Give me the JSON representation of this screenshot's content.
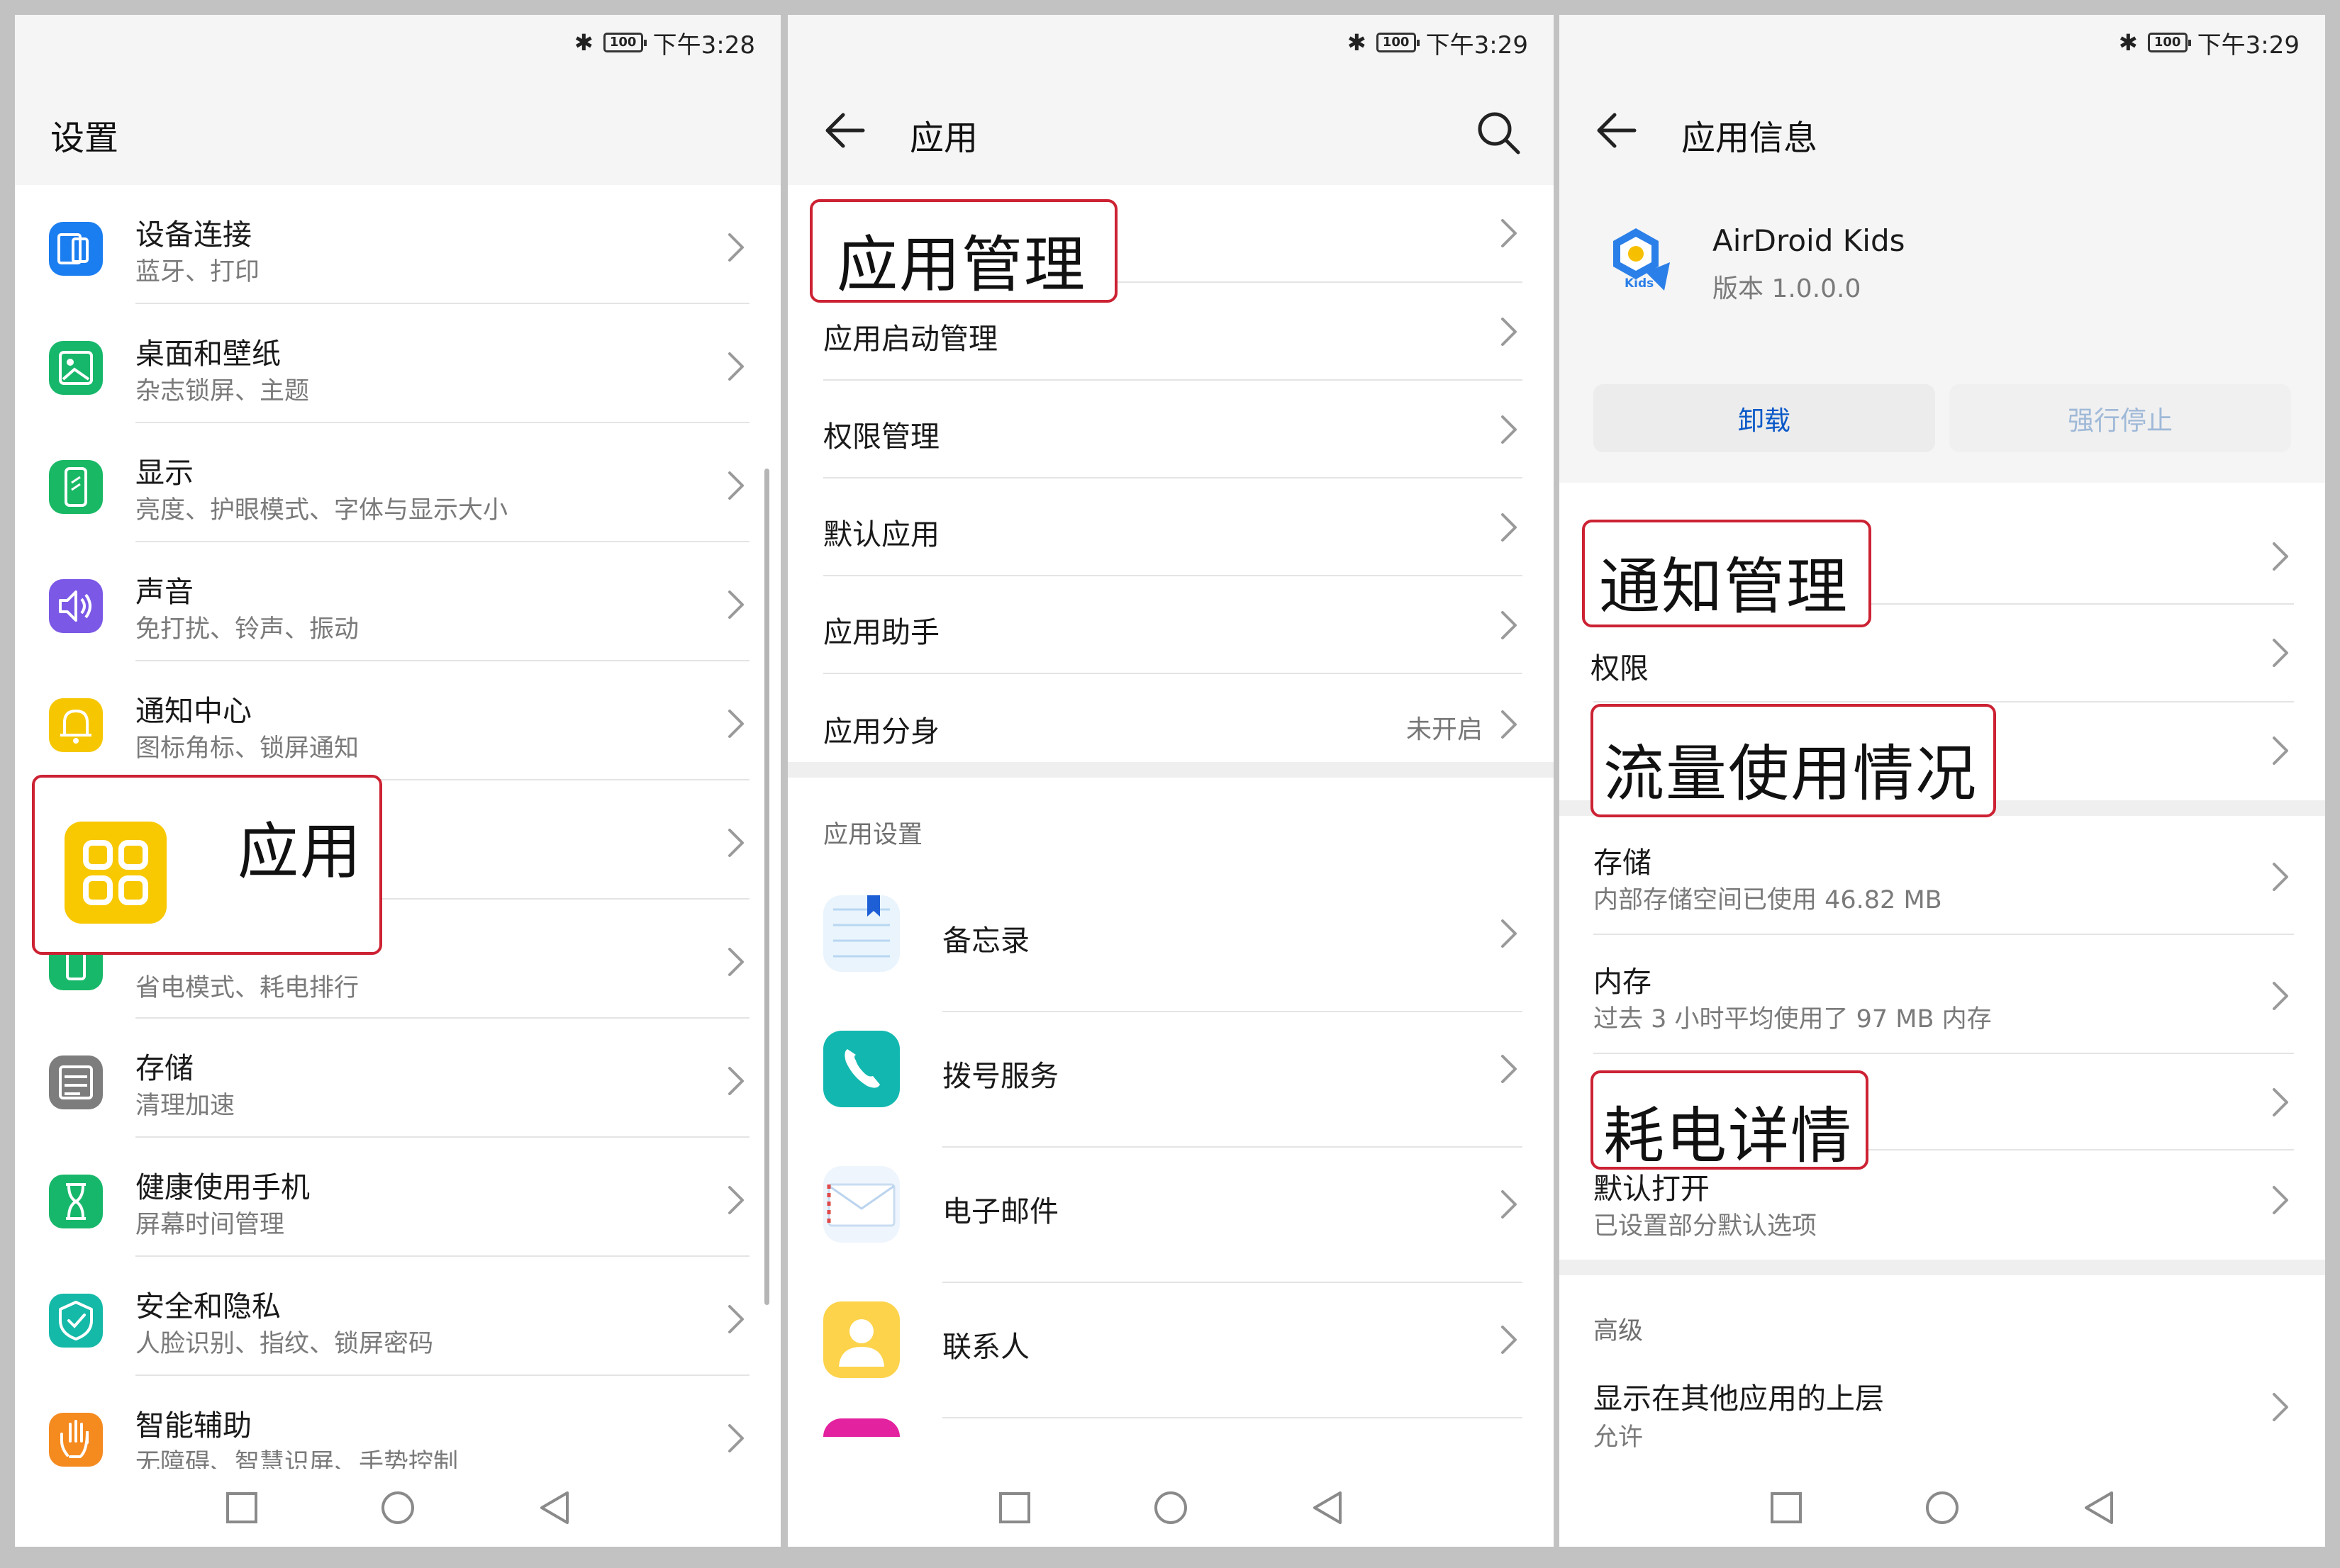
{
  "status": {
    "battery": "100",
    "screens": [
      {
        "time": "下午3:28"
      },
      {
        "time": "下午3:29"
      },
      {
        "time": "下午3:29"
      }
    ]
  },
  "settings": {
    "title": "设置",
    "items": [
      {
        "title": "设备连接",
        "subtitle": "蓝牙、打印",
        "icon": "device-connection-icon",
        "color": "#1a7df0"
      },
      {
        "title": "桌面和壁纸",
        "subtitle": "杂志锁屏、主题",
        "icon": "wallpaper-icon",
        "color": "#17b76b"
      },
      {
        "title": "显示",
        "subtitle": "亮度、护眼模式、字体与显示大小",
        "icon": "display-icon",
        "color": "#19b865"
      },
      {
        "title": "声音",
        "subtitle": "免打扰、铃声、振动",
        "icon": "sound-icon",
        "color": "#7b58e6"
      },
      {
        "title": "通知中心",
        "subtitle": "图标角标、锁屏通知",
        "icon": "bell-icon",
        "color": "#f6c700"
      },
      {
        "title": "",
        "subtitle": "",
        "icon": "",
        "color": "#f6c700"
      },
      {
        "title": "",
        "subtitle": "省电模式、耗电排行",
        "icon": "battery-icon",
        "color": "#18b86a"
      },
      {
        "title": "存储",
        "subtitle": "清理加速",
        "icon": "storage-icon",
        "color": "#7d7d7d"
      },
      {
        "title": "健康使用手机",
        "subtitle": "屏幕时间管理",
        "icon": "hourglass-icon",
        "color": "#17b76b"
      },
      {
        "title": "安全和隐私",
        "subtitle": "人脸识别、指纹、锁屏密码",
        "icon": "shield-icon",
        "color": "#14b9a8"
      },
      {
        "title": "智能辅助",
        "subtitle": "无障碍、智慧识屏、手势控制",
        "icon": "hand-icon",
        "color": "#f58a1f"
      }
    ],
    "callout": {
      "label": "应用",
      "icon": "apps-grid-icon",
      "color": "#f8c800"
    }
  },
  "apps": {
    "title": "应用",
    "callout": {
      "label": "应用管理"
    },
    "items": [
      {
        "title": "应用启动管理"
      },
      {
        "title": "权限管理"
      },
      {
        "title": "默认应用"
      },
      {
        "title": "应用助手"
      },
      {
        "title": "应用分身",
        "value": "未开启"
      }
    ],
    "section": "应用设置",
    "app_list": [
      {
        "title": "备忘录",
        "icon": "notepad-icon"
      },
      {
        "title": "拨号服务",
        "icon": "phone-icon"
      },
      {
        "title": "电子邮件",
        "icon": "mail-icon"
      },
      {
        "title": "联系人",
        "icon": "contacts-icon"
      }
    ]
  },
  "app_info": {
    "title": "应用信息",
    "app_name": "AirDroid Kids",
    "version": "版本 1.0.0.0",
    "logo_text": "Kids",
    "uninstall": "卸载",
    "force_stop": "强行停止",
    "callouts": [
      "通知管理",
      "流量使用情况",
      "耗电详情"
    ],
    "permissions": "权限",
    "storage": {
      "title": "存储",
      "subtitle": "内部存储空间已使用 46.82 MB"
    },
    "memory": {
      "title": "内存",
      "subtitle": "过去 3 小时平均使用了 97 MB 内存"
    },
    "default_open": {
      "title": "默认打开",
      "subtitle": "已设置部分默认选项"
    },
    "section": "高级",
    "overlay": {
      "title": "显示在其他应用的上层",
      "subtitle": "允许"
    },
    "colors": {
      "accent": "#0a59c8",
      "disabled": "#9fb9d8",
      "callout_border": "#cc2233"
    }
  }
}
